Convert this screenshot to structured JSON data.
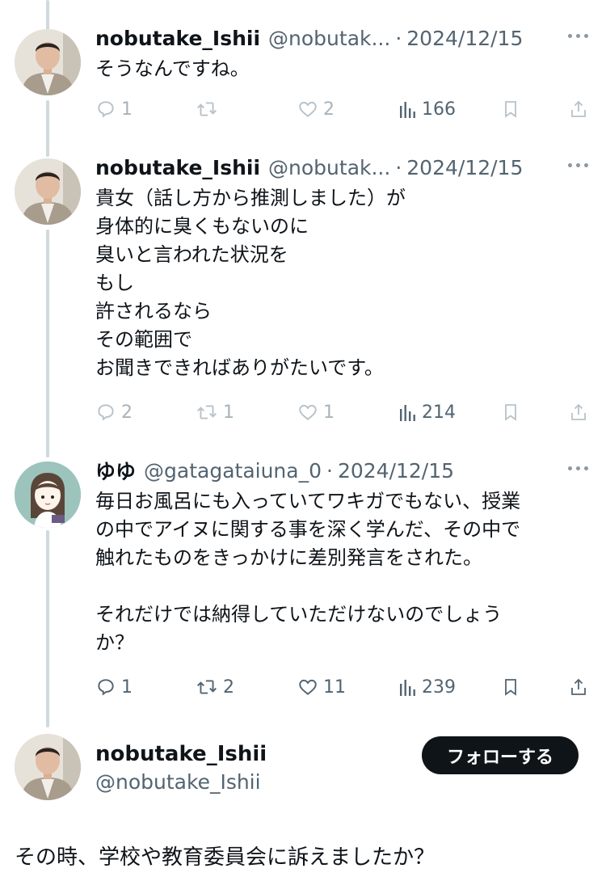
{
  "tweets": [
    {
      "display_name": "nobutake_Ishii",
      "handle": "@nobutak...",
      "separator": "·",
      "date": "2024/12/15",
      "text": "そうなんですね。",
      "replies": "1",
      "retweets": "",
      "likes": "2",
      "views": "166"
    },
    {
      "display_name": "nobutake_Ishii",
      "handle": "@nobutak...",
      "separator": "·",
      "date": "2024/12/15",
      "text": "貴女（話し方から推測しました）が\n身体的に臭くもないのに\n臭いと言われた状況を\nもし\n許されるなら\nその範囲で\nお聞きできればありがたいです。",
      "replies": "2",
      "retweets": "1",
      "likes": "1",
      "views": "214"
    },
    {
      "display_name": "ゆゆ",
      "handle": "@gatagataiuna_0",
      "separator": "·",
      "date": "2024/12/15",
      "text": "毎日お風呂にも入っていてワキガでもない、授業\nの中でアイヌに関する事を深く学んだ、その中で\n触れたものをきっかけに差別発言をされた。\n\nそれだけでは納得していただけないのでしょう\nか？",
      "replies": "1",
      "retweets": "2",
      "likes": "11",
      "views": "239"
    }
  ],
  "main_tweet": {
    "display_name": "nobutake_Ishii",
    "handle": "@nobutake_Ishii",
    "follow_label": "フォローする",
    "text": "その時、学校や教育委員会に訴えましたか？"
  },
  "icons": [
    "reply-icon",
    "retweet-icon",
    "like-icon",
    "views-icon",
    "bookmark-icon",
    "share-icon",
    "more-icon"
  ],
  "colors": {
    "text": "#0f1419",
    "secondary": "#536471",
    "muted": "#a8b3bb",
    "thread_line": "#cfd9de",
    "button": "#0f1419"
  }
}
